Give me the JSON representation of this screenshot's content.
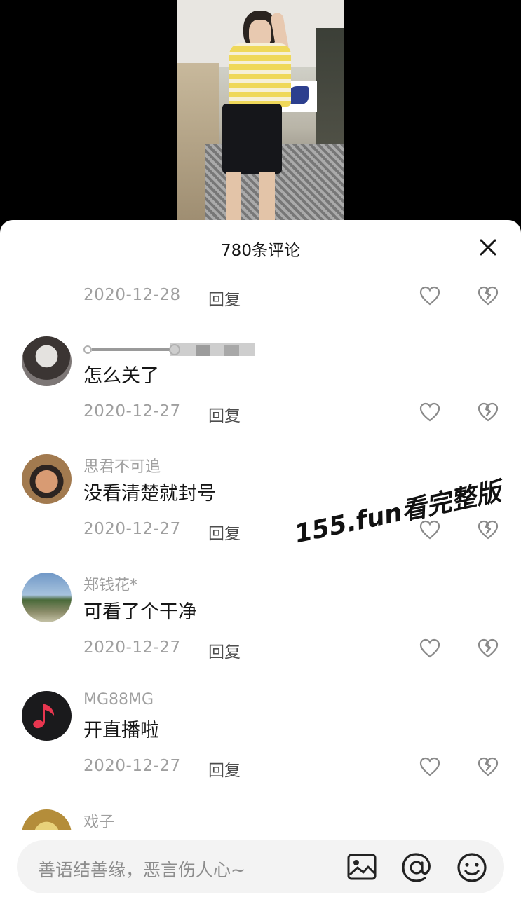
{
  "panel": {
    "title": "780条评论"
  },
  "top_partial": {
    "date": "2020-12-28",
    "reply_label": "回复"
  },
  "comments": [
    {
      "username": "",
      "text": "怎么关了",
      "date": "2020-12-27",
      "reply_label": "回复",
      "avatar": "avatar-woman-dark-hair"
    },
    {
      "username": "思君不可追",
      "text": "没看清楚就封号",
      "date": "2020-12-27",
      "reply_label": "回复",
      "avatar": "avatar-man-headband"
    },
    {
      "username": "郑钱花*",
      "text": "可看了个干净",
      "date": "2020-12-27",
      "reply_label": "回复",
      "avatar": "avatar-landscape"
    },
    {
      "username": "MG88MG",
      "text": "开直播啦",
      "date": "2020-12-27",
      "reply_label": "回复",
      "avatar": "avatar-music-note"
    },
    {
      "username": "戏子",
      "text": "",
      "date": "",
      "reply_label": "",
      "avatar": "avatar-yellow"
    }
  ],
  "watermark": "155.fun看完整版",
  "input": {
    "placeholder": "善语结善缘，恶言伤人心~"
  },
  "icons": [
    "close-icon",
    "like-icon",
    "dislike-icon",
    "image-icon",
    "at-icon",
    "emoji-icon"
  ],
  "colors": {
    "music_accent": "#e8364f",
    "text_primary": "#161616",
    "text_secondary": "#9f9f9f"
  }
}
